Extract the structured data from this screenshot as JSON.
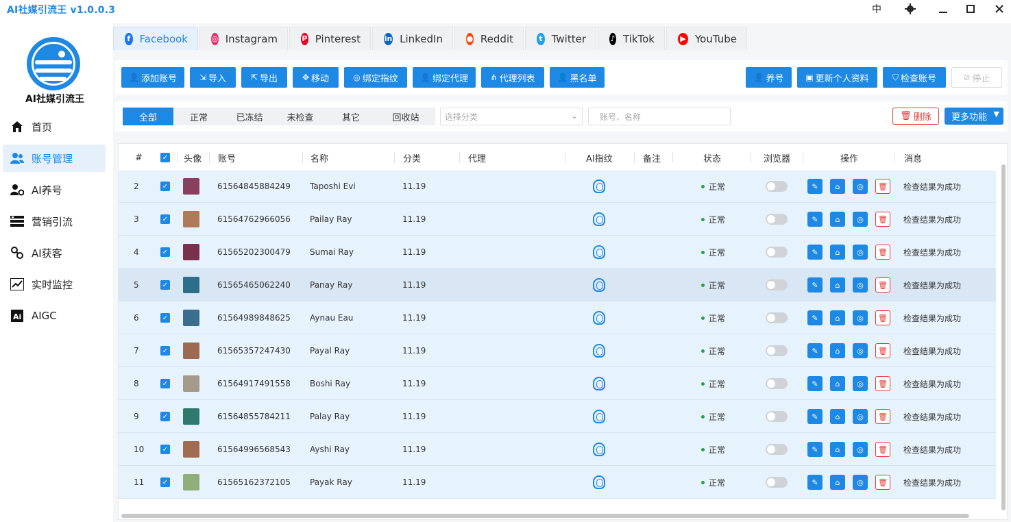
{
  "app": {
    "title": "AI社媒引流王 v1.0.0.3"
  },
  "window": {
    "lang": "中"
  },
  "sidebar": {
    "logo_text": "AI社媒引流王",
    "items": [
      {
        "label": "首页",
        "icon": "home-icon"
      },
      {
        "label": "账号管理",
        "icon": "users-icon",
        "active": true
      },
      {
        "label": "AI养号",
        "icon": "user-gear-icon"
      },
      {
        "label": "营销引流",
        "icon": "list-icon"
      },
      {
        "label": "AI获客",
        "icon": "link-icon"
      },
      {
        "label": "实时监控",
        "icon": "chart-icon"
      },
      {
        "label": "AIGC",
        "icon": "ai-icon"
      }
    ]
  },
  "tabs": [
    {
      "label": "Facebook",
      "color": "#1877f2",
      "active": true
    },
    {
      "label": "Instagram",
      "color": "#e1306c"
    },
    {
      "label": "Pinterest",
      "color": "#e60023"
    },
    {
      "label": "LinkedIn",
      "color": "#0a66c2"
    },
    {
      "label": "Reddit",
      "color": "#ff4500"
    },
    {
      "label": "Twitter",
      "color": "#1da1f2"
    },
    {
      "label": "TikTok",
      "color": "#000000"
    },
    {
      "label": "YouTube",
      "color": "#ff0000"
    }
  ],
  "toolbar": {
    "add_account": "添加账号",
    "import": "导入",
    "export": "导出",
    "move": "移动",
    "bind_fingerprint": "绑定指纹",
    "bind_proxy": "绑定代理",
    "proxy_list": "代理列表",
    "blacklist": "黑名单",
    "nurture": "养号",
    "update_profile": "更新个人资料",
    "check_account": "检查账号",
    "stop": "停止"
  },
  "filters": {
    "tabs": [
      "全部",
      "正常",
      "已冻结",
      "未检查",
      "其它",
      "回收站"
    ],
    "category_placeholder": "选择分类",
    "search_placeholder": "账号、名称",
    "delete": "删除",
    "more": "更多功能"
  },
  "table": {
    "headers": {
      "index": "#",
      "avatar": "头像",
      "account": "账号",
      "name": "名称",
      "category": "分类",
      "proxy": "代理",
      "fingerprint": "AI指纹",
      "note": "备注",
      "status": "状态",
      "browser": "浏览器",
      "actions": "操作",
      "message": "消息"
    },
    "rows": [
      {
        "index": "2",
        "account": "61564845884249",
        "name": "Taposhi Evi",
        "category": "11.19",
        "status": "正常",
        "message": "检查结果为成功",
        "avatar_color": "#8a3f5e"
      },
      {
        "index": "3",
        "account": "61564762966056",
        "name": "Pailay Ray",
        "category": "11.19",
        "status": "正常",
        "message": "检查结果为成功",
        "avatar_color": "#b07a5a"
      },
      {
        "index": "4",
        "account": "61565202300479",
        "name": "Sumai Ray",
        "category": "11.19",
        "status": "正常",
        "message": "检查结果为成功",
        "avatar_color": "#7a2f4a"
      },
      {
        "index": "5",
        "account": "61565465062240",
        "name": "Panay Ray",
        "category": "11.19",
        "status": "正常",
        "message": "检查结果为成功",
        "avatar_color": "#2b6f8a"
      },
      {
        "index": "6",
        "account": "61564989848625",
        "name": "Aynau Eau",
        "category": "11.19",
        "status": "正常",
        "message": "检查结果为成功",
        "avatar_color": "#3a6e8c"
      },
      {
        "index": "7",
        "account": "61565357247430",
        "name": "Payal Ray",
        "category": "11.19",
        "status": "正常",
        "message": "检查结果为成功",
        "avatar_color": "#9c6a52"
      },
      {
        "index": "8",
        "account": "61564917491558",
        "name": "Boshi Ray",
        "category": "11.19",
        "status": "正常",
        "message": "检查结果为成功",
        "avatar_color": "#a39a8a"
      },
      {
        "index": "9",
        "account": "61564855784211",
        "name": "Palay Ray",
        "category": "11.19",
        "status": "正常",
        "message": "检查结果为成功",
        "avatar_color": "#2e7a6e"
      },
      {
        "index": "10",
        "account": "61564996568543",
        "name": "Ayshi Ray",
        "category": "11.19",
        "status": "正常",
        "message": "检查结果为成功",
        "avatar_color": "#a06b4e"
      },
      {
        "index": "11",
        "account": "61565162372105",
        "name": "Payak Ray",
        "category": "11.19",
        "status": "正常",
        "message": "检查结果为成功",
        "avatar_color": "#8fae7a"
      }
    ]
  }
}
